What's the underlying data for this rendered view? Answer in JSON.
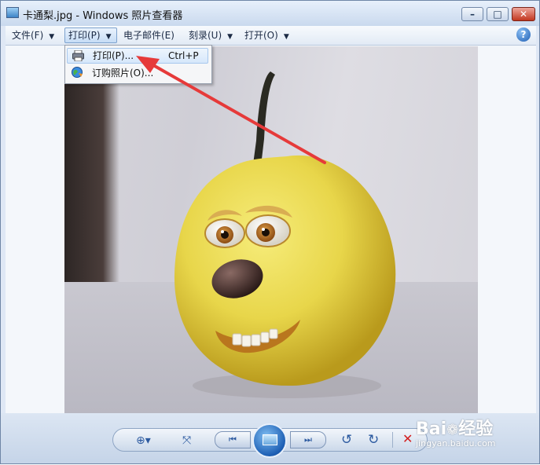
{
  "window": {
    "title": "卡通梨.jpg - Windows 照片查看器",
    "minimize": "–",
    "maximize": "□",
    "close": "✕"
  },
  "menu": {
    "file": "文件(F)",
    "print": "打印(P)",
    "email": "电子邮件(E)",
    "burn": "刻录(U)",
    "open": "打开(O)",
    "help": "?",
    "arrow": "▼"
  },
  "dropdown": {
    "items": [
      {
        "label": "打印(P)...",
        "shortcut": "Ctrl+P",
        "icon": "printer-icon"
      },
      {
        "label": "订购照片(O)...",
        "icon": "globe-order-icon"
      }
    ]
  },
  "photo": {
    "subject": "cartoon-pear-image"
  },
  "toolbar": {
    "zoom": "⊕▾",
    "fit": "⤧",
    "prev": "⏮",
    "next": "⏭",
    "rotate_ccw": "↺",
    "rotate_cw": "↻",
    "delete": "✕"
  },
  "watermark": {
    "brand": "Bai",
    "paw": "❁",
    "cn": "经验",
    "sub": "jingyan.baidu.com"
  },
  "colors": {
    "accent": "#2c5aa0",
    "annotation_arrow": "#e63a3a",
    "delete": "#d32020"
  }
}
